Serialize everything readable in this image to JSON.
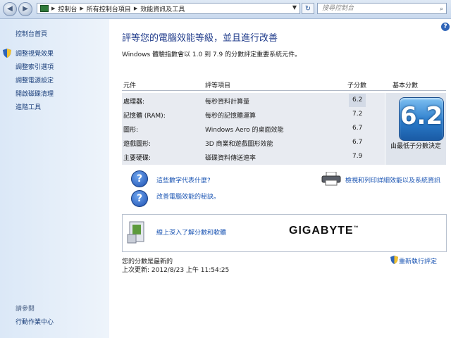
{
  "address_bar": {
    "crumbs": [
      "控制台",
      "所有控制台項目",
      "效能資訊及工具"
    ],
    "search_placeholder": "搜尋控制台"
  },
  "sidebar": {
    "home": "控制台首頁",
    "items": [
      "調整視覺效果",
      "調整索引選項",
      "調整電源設定",
      "開啟磁碟清理",
      "進階工具"
    ],
    "see_also": "請參閱",
    "action_center": "行動作業中心"
  },
  "main": {
    "title": "評等您的電腦效能等級，並且進行改善",
    "subtitle": "Windows 體驗指數會以 1.0 到 7.9 的分數評定重要系統元件。",
    "table": {
      "headers": [
        "元件",
        "評等項目",
        "子分數",
        "基本分數"
      ],
      "rows": [
        {
          "component": "處理器:",
          "desc": "每秒資料計算量",
          "score": "6.2"
        },
        {
          "component": "記憶體 (RAM):",
          "desc": "每秒的記憶體運算",
          "score": "7.2"
        },
        {
          "component": "圖形:",
          "desc": "Windows Aero 的桌面效能",
          "score": "6.7"
        },
        {
          "component": "遊戲圖形:",
          "desc": "3D 商業和遊戲圖形效能",
          "score": "6.7"
        },
        {
          "component": "主要硬碟:",
          "desc": "磁碟資料傳送速率",
          "score": "7.9"
        }
      ],
      "base_score": "6.2",
      "base_caption": "由最低子分數決定"
    },
    "links": {
      "what_numbers": "這些數字代表什麼?",
      "tips": "改善電腦效能的秘訣。",
      "print": "檢視和列印詳細效能以及系統資訊"
    },
    "oem": {
      "link": "線上深入了解分數和軟體",
      "logo": "GIGABYTE",
      "tm": "™"
    },
    "status": {
      "current": "您的分數是最新的",
      "last_update": "上次更新: 2012/8/23 上午 11:54:25",
      "rerun": "重新執行評定"
    }
  }
}
